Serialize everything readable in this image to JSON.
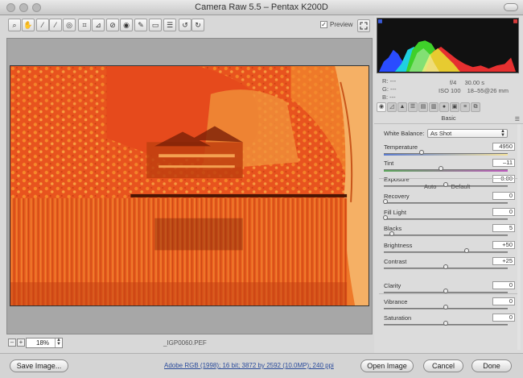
{
  "window": {
    "title": "Camera Raw 5.5  –  Pentax K200D"
  },
  "toolbar": {
    "tools": [
      {
        "name": "zoom-tool-icon",
        "glyph": "⌕"
      },
      {
        "name": "hand-tool-icon",
        "glyph": "✋"
      },
      {
        "name": "white-balance-tool-icon",
        "glyph": "⁄"
      },
      {
        "name": "color-sampler-tool-icon",
        "glyph": "⁄"
      },
      {
        "name": "targeted-adjustment-tool-icon",
        "glyph": "◎"
      },
      {
        "name": "crop-tool-icon",
        "glyph": "⌗"
      },
      {
        "name": "straighten-tool-icon",
        "glyph": "⊿"
      },
      {
        "name": "spot-removal-tool-icon",
        "glyph": "⊘"
      },
      {
        "name": "red-eye-tool-icon",
        "glyph": "◉"
      },
      {
        "name": "adjustment-brush-icon",
        "glyph": "✎"
      },
      {
        "name": "graduated-filter-icon",
        "glyph": "▭"
      },
      {
        "name": "preferences-icon",
        "glyph": "☰"
      },
      {
        "name": "rotate-left-icon",
        "glyph": "↺"
      },
      {
        "name": "rotate-right-icon",
        "glyph": "↻"
      }
    ],
    "preview_label": "Preview",
    "preview_checked": "✓"
  },
  "canvas": {
    "zoom_value": "18%",
    "filename": "_IGP0060.PEF",
    "zoom_out_label": "–",
    "zoom_in_label": "+"
  },
  "histogram": {
    "r": "R:   ---",
    "g": "G:   ---",
    "b": "B:   ---",
    "aperture": "f/4",
    "shutter": "30.00 s",
    "iso": "ISO 100",
    "lens": "18–55@26 mm"
  },
  "panel": {
    "section_title": "Basic",
    "white_balance_label": "White Balance:",
    "white_balance_value": "As Shot",
    "auto_label": "Auto",
    "default_label": "Default",
    "sliders": {
      "temperature": {
        "label": "Temperature",
        "value": "4950",
        "level": 0.3
      },
      "tint": {
        "label": "Tint",
        "value": "–11",
        "level": 0.46
      },
      "exposure": {
        "label": "Exposure",
        "value": "0.00",
        "level": 0.5
      },
      "recovery": {
        "label": "Recovery",
        "value": "0",
        "level": 0.0
      },
      "fill_light": {
        "label": "Fill Light",
        "value": "0",
        "level": 0.0
      },
      "blacks": {
        "label": "Blacks",
        "value": "5",
        "level": 0.05
      },
      "brightness": {
        "label": "Brightness",
        "value": "+50",
        "level": 0.67
      },
      "contrast": {
        "label": "Contrast",
        "value": "+25",
        "level": 0.5
      },
      "clarity": {
        "label": "Clarity",
        "value": "0",
        "level": 0.5
      },
      "vibrance": {
        "label": "Vibrance",
        "value": "0",
        "level": 0.5
      },
      "saturation": {
        "label": "Saturation",
        "value": "0",
        "level": 0.5
      }
    }
  },
  "bottom": {
    "save_label": "Save Image...",
    "workflow_label": "Adobe RGB (1998); 16 bit; 3872 by 2592 (10.0MP); 240 ppi",
    "open_label": "Open Image",
    "cancel_label": "Cancel",
    "done_label": "Done"
  },
  "colors": {
    "photo_primary": "#e8531e",
    "photo_secondary": "#f58a2a",
    "photo_dark": "#7a1f06"
  }
}
